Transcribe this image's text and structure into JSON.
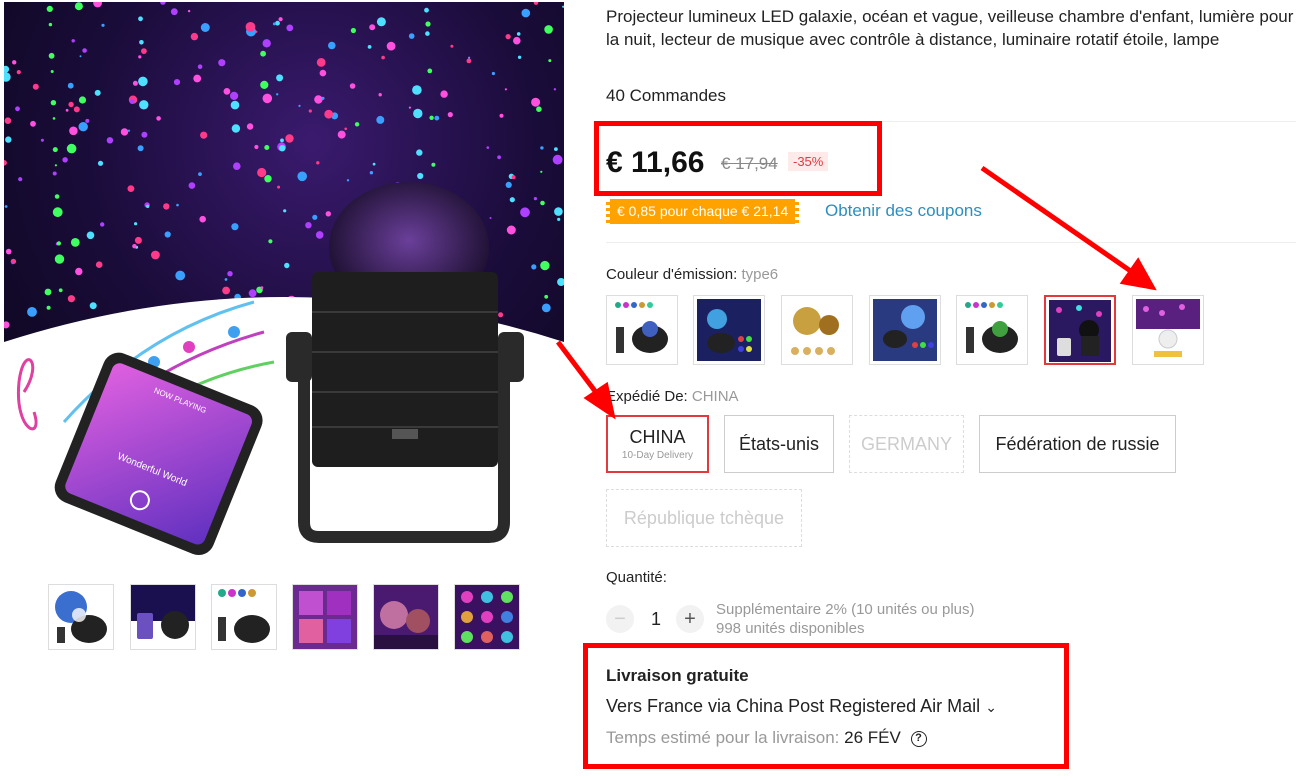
{
  "product": {
    "title": "Projecteur lumineux LED galaxie, océan et vague, veilleuse chambre d'enfant, lumière pour la nuit, lecteur de musique avec contrôle à distance, luminaire rotatif étoile, lampe",
    "orders": "40 Commandes",
    "phone_screen_label": "NOW PLAYING",
    "phone_song": "Wonderful World"
  },
  "price": {
    "current": "€ 11,66",
    "original": "€ 17,94",
    "discount": "-35%"
  },
  "coupon": {
    "badge": "€ 0,85 pour chaque € 21,14",
    "link": "Obtenir des coupons"
  },
  "color": {
    "label": "Couleur d'émission:",
    "selected": "type6",
    "swatches": [
      "type1",
      "type2",
      "type3",
      "type4",
      "type5",
      "type6",
      "type7"
    ]
  },
  "ship_from": {
    "label": "Expédié De:",
    "selected": "CHINA",
    "options": [
      {
        "name": "CHINA",
        "note": "10-Day Delivery"
      },
      {
        "name": "États-unis"
      },
      {
        "name": "GERMANY"
      },
      {
        "name": "Fédération de russie"
      },
      {
        "name": "République tchèque"
      }
    ]
  },
  "quantity": {
    "label": "Quantité:",
    "minus": "−",
    "plus": "+",
    "value": "1",
    "extra": "Supplémentaire 2% (10 unités ou plus)",
    "available": "998 unités disponibles"
  },
  "shipping": {
    "title": "Livraison gratuite",
    "route": "Vers France via China Post Registered Air Mail",
    "chevron": "⌄",
    "time_label": "Temps estimé pour la livraison:",
    "time_value": "26 FÉV",
    "help": "?"
  },
  "colors": {
    "accent": "#e4393c",
    "coupon_bg": "#ffa200",
    "link": "#2a8fc1",
    "annotation": "#ff0000"
  }
}
